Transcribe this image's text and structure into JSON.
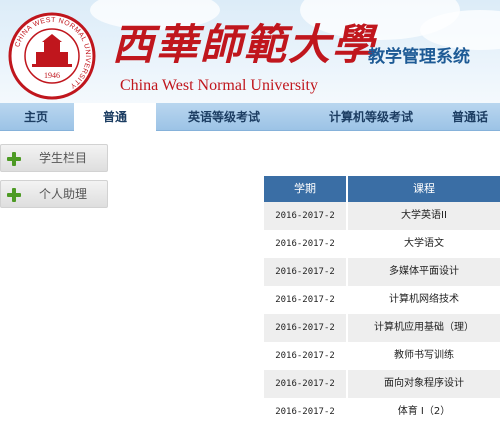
{
  "header": {
    "logo_cn": "西華師範大學",
    "logo_en": "China West Normal University",
    "system_title": "教学管理系统",
    "seal_text": "CHINA WEST NORMAL UNIVERSITY",
    "seal_year": "1946",
    "brand_color": "#c0161d",
    "title_color": "#1d5a95"
  },
  "nav": {
    "tabs": [
      {
        "label": "主页"
      },
      {
        "label": "普通",
        "active": true
      },
      {
        "label": "英语等级考试"
      },
      {
        "label": "计算机等级考试"
      },
      {
        "label": "普通话"
      }
    ]
  },
  "sidebar": {
    "items": [
      {
        "label": "学生栏目",
        "icon": "plus-icon"
      },
      {
        "label": "个人助理",
        "icon": "plus-icon"
      }
    ]
  },
  "table": {
    "columns": [
      "学期",
      "课程"
    ],
    "header_color": "#3a6ea5",
    "rows": [
      {
        "term": "2016-2017-2",
        "course": "大学英语II"
      },
      {
        "term": "2016-2017-2",
        "course": "大学语文"
      },
      {
        "term": "2016-2017-2",
        "course": "多媒体平面设计"
      },
      {
        "term": "2016-2017-2",
        "course": "计算机网络技术"
      },
      {
        "term": "2016-2017-2",
        "course": "计算机应用基础（理）"
      },
      {
        "term": "2016-2017-2",
        "course": "教师书写训练"
      },
      {
        "term": "2016-2017-2",
        "course": "面向对象程序设计"
      },
      {
        "term": "2016-2017-2",
        "course": "体育 I（2）"
      }
    ]
  }
}
